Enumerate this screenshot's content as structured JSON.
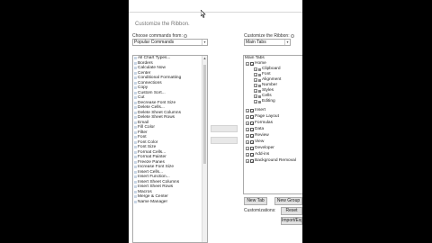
{
  "dialog": {
    "pane_title": "Customize the Ribbon."
  },
  "left": {
    "label": "Choose commands from:",
    "dropdown_value": "Popular Commands",
    "items": [
      "All Chart Types...",
      "Borders",
      "Calculate Now",
      "Center",
      "Conditional Formatting",
      "Connections",
      "Copy",
      "Custom Sort...",
      "Cut",
      "Decrease Font Size",
      "Delete Cells...",
      "Delete Sheet Columns",
      "Delete Sheet Rows",
      "Email",
      "Fill Color",
      "Filter",
      "Font",
      "Font Color",
      "Font Size",
      "Format Cells...",
      "Format Painter",
      "Freeze Panes",
      "Increase Font Size",
      "Insert Cells...",
      "Insert Function...",
      "Insert Sheet Columns",
      "Insert Sheet Rows",
      "Macros",
      "Merge & Center",
      "Name Manager"
    ]
  },
  "right": {
    "label": "Customize the Ribbon:",
    "dropdown_value": "Main Tabs",
    "tree_header": "Main Tabs",
    "home_label": "Home",
    "home_groups": [
      "Clipboard",
      "Font",
      "Alignment",
      "Number",
      "Styles",
      "Cells",
      "Editing"
    ],
    "tabs": [
      "Insert",
      "Page Layout",
      "Formulas",
      "Data",
      "Review",
      "View",
      "Developer",
      "Add-ins",
      "Background Removal"
    ]
  },
  "buttons": {
    "new_tab": "New Tab",
    "new_group": "New Group",
    "reset": "Reset",
    "import_export": "Import/Export"
  },
  "customizations_label": "Customizations:"
}
